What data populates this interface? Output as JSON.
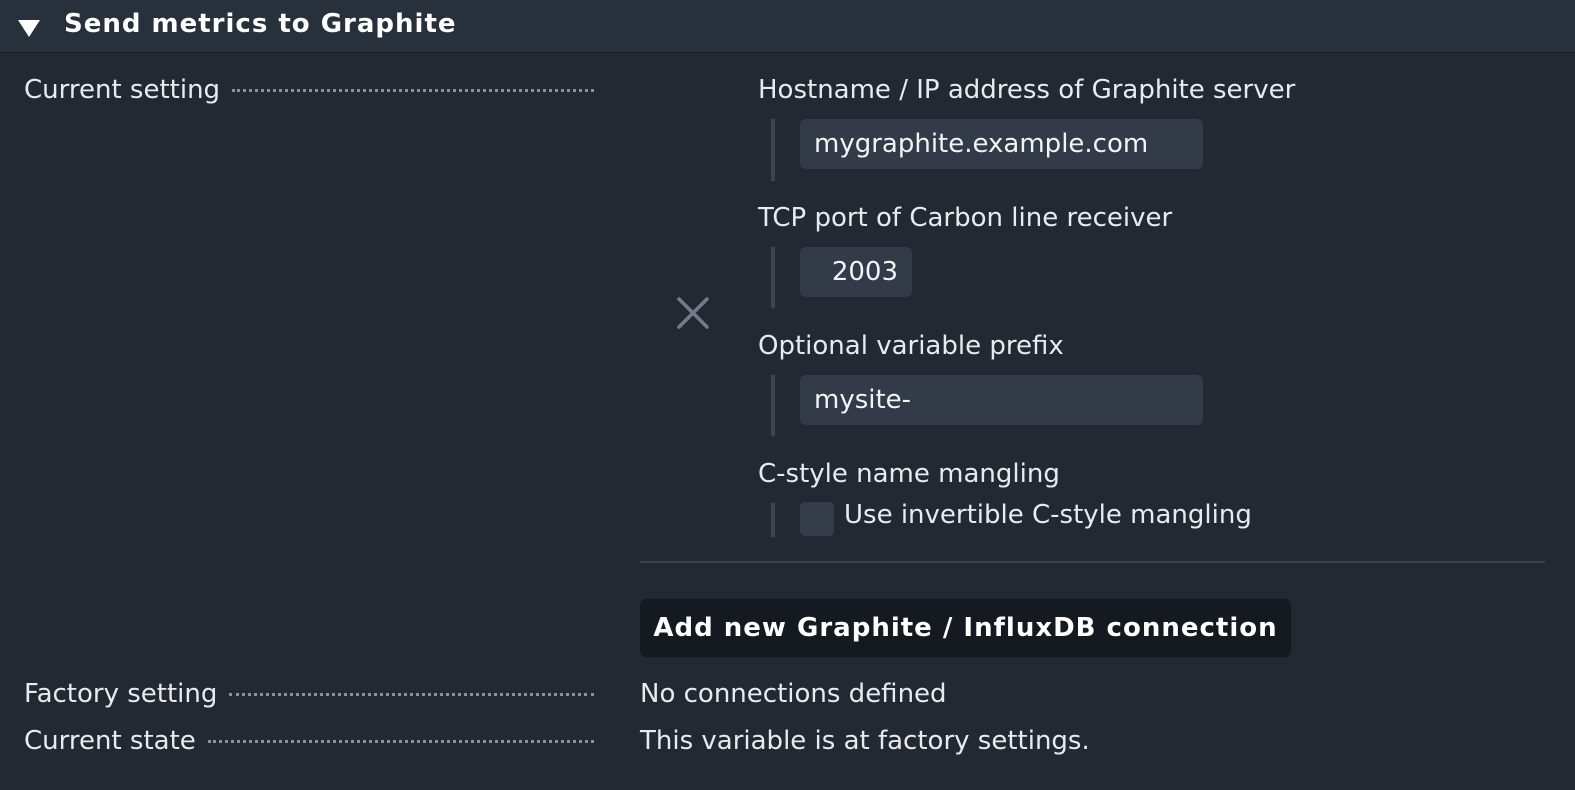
{
  "header": {
    "title": "Send metrics to Graphite",
    "toggle_icon": "triangle-down-icon"
  },
  "rows": {
    "current_setting": "Current setting",
    "factory_setting": "Factory setting",
    "current_state": "Current state"
  },
  "connection": {
    "remove_icon": "close-icon",
    "hostname": {
      "label": "Hostname / IP address of Graphite server",
      "value": "mygraphite.example.com"
    },
    "port": {
      "label": "TCP port of Carbon line receiver",
      "value": "2003"
    },
    "prefix": {
      "label": "Optional variable prefix",
      "value": "mysite-"
    },
    "mangling": {
      "label": "C-style name mangling",
      "checkbox_label": "Use invertible C-style mangling",
      "checked": false
    }
  },
  "add_button_label": "Add new Graphite / InfluxDB connection",
  "factory_value": "No connections defined",
  "state_value": "This variable is at factory settings.",
  "colors": {
    "background": "#222933",
    "header_bg": "#28303b",
    "input_bg": "#323b47",
    "button_bg": "#141a20"
  }
}
